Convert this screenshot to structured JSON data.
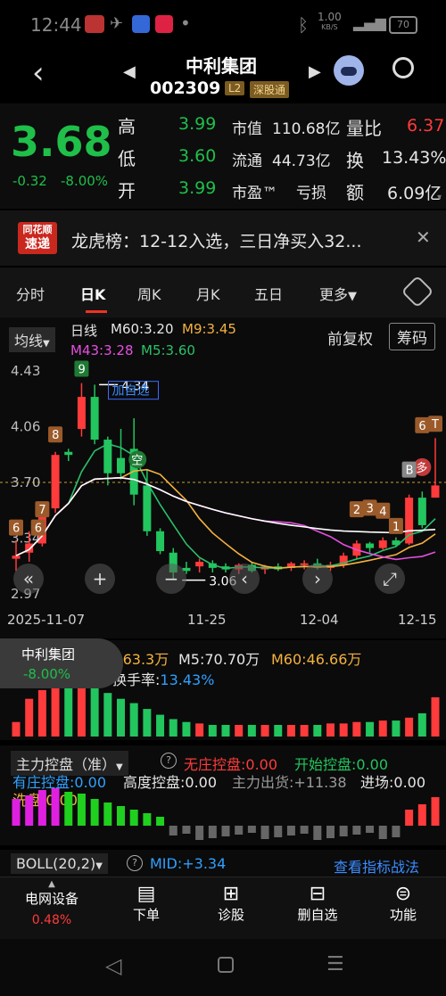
{
  "status_bar": {
    "time": "12:44",
    "net_speed": "1.00",
    "net_unit": "KB/S",
    "battery": "70"
  },
  "header": {
    "name": "中利集团",
    "code": "002309",
    "level": "L2",
    "exchange": "深股通"
  },
  "quote": {
    "price": "3.68",
    "change": "-0.32",
    "change_pct": "-8.00%",
    "high_label": "高",
    "high": "3.99",
    "low_label": "低",
    "low": "3.60",
    "open_label": "开",
    "open": "3.99",
    "mcap_label": "市值",
    "mcap": "110.68亿",
    "float_label": "流通",
    "float": "44.73亿",
    "pe_label": "市盈™",
    "pe": "亏损",
    "vr_label": "量比",
    "vr": "6.37",
    "turn_label": "换",
    "turn": "13.43%",
    "amt_label": "额",
    "amt": "6.09亿"
  },
  "banner": {
    "logo_top": "同花顺",
    "logo_bottom": "速递",
    "text": "龙虎榜：12-12入选，三日净买入32..."
  },
  "tabs": [
    "分时",
    "日K",
    "周K",
    "月K",
    "五日",
    "更多"
  ],
  "active_tab": 1,
  "kline": {
    "ma_mode": "均线",
    "line_type": "日线",
    "m60": "M60:3.20",
    "m9": "M9:3.45",
    "m43": "M43:3.28",
    "m5": "M5:3.60",
    "adjust": "前复权",
    "chips": "筹码",
    "y_labels": [
      "4.43",
      "4.06",
      "3.70",
      "3.34",
      "2.97"
    ],
    "dates": [
      "2025-11-07",
      "11-25",
      "12-04",
      "12-15"
    ],
    "high_mark": "4.34",
    "low_mark": "3.06",
    "add_watch": "加自选",
    "kong": "空",
    "duo": "多",
    "badges": [
      "6",
      "6",
      "7",
      "8",
      "9",
      "1",
      "2",
      "3",
      "4",
      "B",
      "6",
      "T"
    ],
    "overlay_name": "中利集团",
    "overlay_pct": "-8.00%"
  },
  "chart_data": {
    "type": "candlestick",
    "x_start": "2025-11-07",
    "x_end": "2025-12-15",
    "ylim": [
      2.97,
      4.43
    ],
    "candles": [
      {
        "o": 3.2,
        "h": 3.32,
        "l": 3.12,
        "c": 3.22
      },
      {
        "o": 3.24,
        "h": 3.38,
        "l": 3.18,
        "c": 3.3
      },
      {
        "o": 3.3,
        "h": 3.56,
        "l": 3.28,
        "c": 3.53
      },
      {
        "o": 3.53,
        "h": 3.9,
        "l": 3.5,
        "c": 3.88
      },
      {
        "o": 3.9,
        "h": 3.92,
        "l": 3.84,
        "c": 3.88
      },
      {
        "o": 4.05,
        "h": 4.35,
        "l": 4.0,
        "c": 4.26
      },
      {
        "o": 4.26,
        "h": 4.34,
        "l": 3.95,
        "c": 3.98
      },
      {
        "o": 3.98,
        "h": 4.0,
        "l": 3.68,
        "c": 3.76
      },
      {
        "o": 3.86,
        "h": 4.05,
        "l": 3.72,
        "c": 3.76
      },
      {
        "o": 3.92,
        "h": 4.12,
        "l": 3.55,
        "c": 3.62
      },
      {
        "o": 3.68,
        "h": 3.78,
        "l": 3.35,
        "c": 3.38
      },
      {
        "o": 3.38,
        "h": 3.4,
        "l": 3.23,
        "c": 3.25
      },
      {
        "o": 3.24,
        "h": 3.27,
        "l": 3.06,
        "c": 3.11
      },
      {
        "o": 3.14,
        "h": 3.18,
        "l": 3.1,
        "c": 3.12
      },
      {
        "o": 3.15,
        "h": 3.2,
        "l": 3.11,
        "c": 3.18
      },
      {
        "o": 3.17,
        "h": 3.19,
        "l": 3.11,
        "c": 3.14
      },
      {
        "o": 3.15,
        "h": 3.17,
        "l": 3.11,
        "c": 3.13
      },
      {
        "o": 3.13,
        "h": 3.17,
        "l": 3.1,
        "c": 3.16
      },
      {
        "o": 3.16,
        "h": 3.18,
        "l": 3.11,
        "c": 3.12
      },
      {
        "o": 3.13,
        "h": 3.16,
        "l": 3.1,
        "c": 3.15
      },
      {
        "o": 3.15,
        "h": 3.17,
        "l": 3.12,
        "c": 3.13
      },
      {
        "o": 3.14,
        "h": 3.18,
        "l": 3.12,
        "c": 3.17
      },
      {
        "o": 3.16,
        "h": 3.19,
        "l": 3.13,
        "c": 3.17
      },
      {
        "o": 3.17,
        "h": 3.2,
        "l": 3.13,
        "c": 3.14
      },
      {
        "o": 3.14,
        "h": 3.18,
        "l": 3.12,
        "c": 3.16
      },
      {
        "o": 3.16,
        "h": 3.24,
        "l": 3.14,
        "c": 3.22
      },
      {
        "o": 3.22,
        "h": 3.32,
        "l": 3.2,
        "c": 3.3
      },
      {
        "o": 3.3,
        "h": 3.31,
        "l": 3.24,
        "c": 3.27
      },
      {
        "o": 3.27,
        "h": 3.34,
        "l": 3.26,
        "c": 3.32
      },
      {
        "o": 3.32,
        "h": 3.34,
        "l": 3.28,
        "c": 3.29
      },
      {
        "o": 3.3,
        "h": 3.62,
        "l": 3.29,
        "c": 3.6
      },
      {
        "o": 3.6,
        "h": 3.64,
        "l": 3.4,
        "c": 3.42
      },
      {
        "o": 3.6,
        "h": 3.99,
        "l": 3.6,
        "c": 3.68
      }
    ],
    "volume": {
      "m5": "70.70万",
      "m60": "46.66万",
      "value": "163.3万",
      "turnover": "13.43%",
      "bars": [
        1.0,
        2.6,
        3.2,
        3.9,
        4.3,
        4.1,
        3.7,
        3.0,
        2.6,
        2.3,
        1.9,
        1.5,
        1.2,
        1.0,
        0.9,
        0.8,
        0.8,
        0.8,
        0.8,
        0.8,
        0.8,
        0.8,
        0.8,
        0.8,
        0.9,
        0.9,
        1.0,
        1.0,
        1.1,
        1.1,
        1.3,
        1.6,
        2.7
      ]
    },
    "mainforce": {
      "title": "主力控盘（准）",
      "no_control": "无庄控盘:0.00",
      "start": "开始控盘:0.00",
      "has_control": "有庄控盘:0.00",
      "high_control": "高度控盘:0.00",
      "outflow": "主力出货:+11.38",
      "entry": "进场:0.00",
      "wash": "洗盘:0.00"
    },
    "boll": {
      "name": "BOLL(20,2)",
      "mid": "MID:+3.34",
      "link": "查看指标战法"
    }
  },
  "bottom_bar": [
    {
      "label": "电网设备",
      "sub": "0.48%"
    },
    {
      "label": "下单"
    },
    {
      "label": "诊股"
    },
    {
      "label": "删自选"
    },
    {
      "label": "功能"
    }
  ],
  "colors": {
    "up": "#ff3b3b",
    "down": "#22c55e",
    "accent": "#ffffff"
  }
}
